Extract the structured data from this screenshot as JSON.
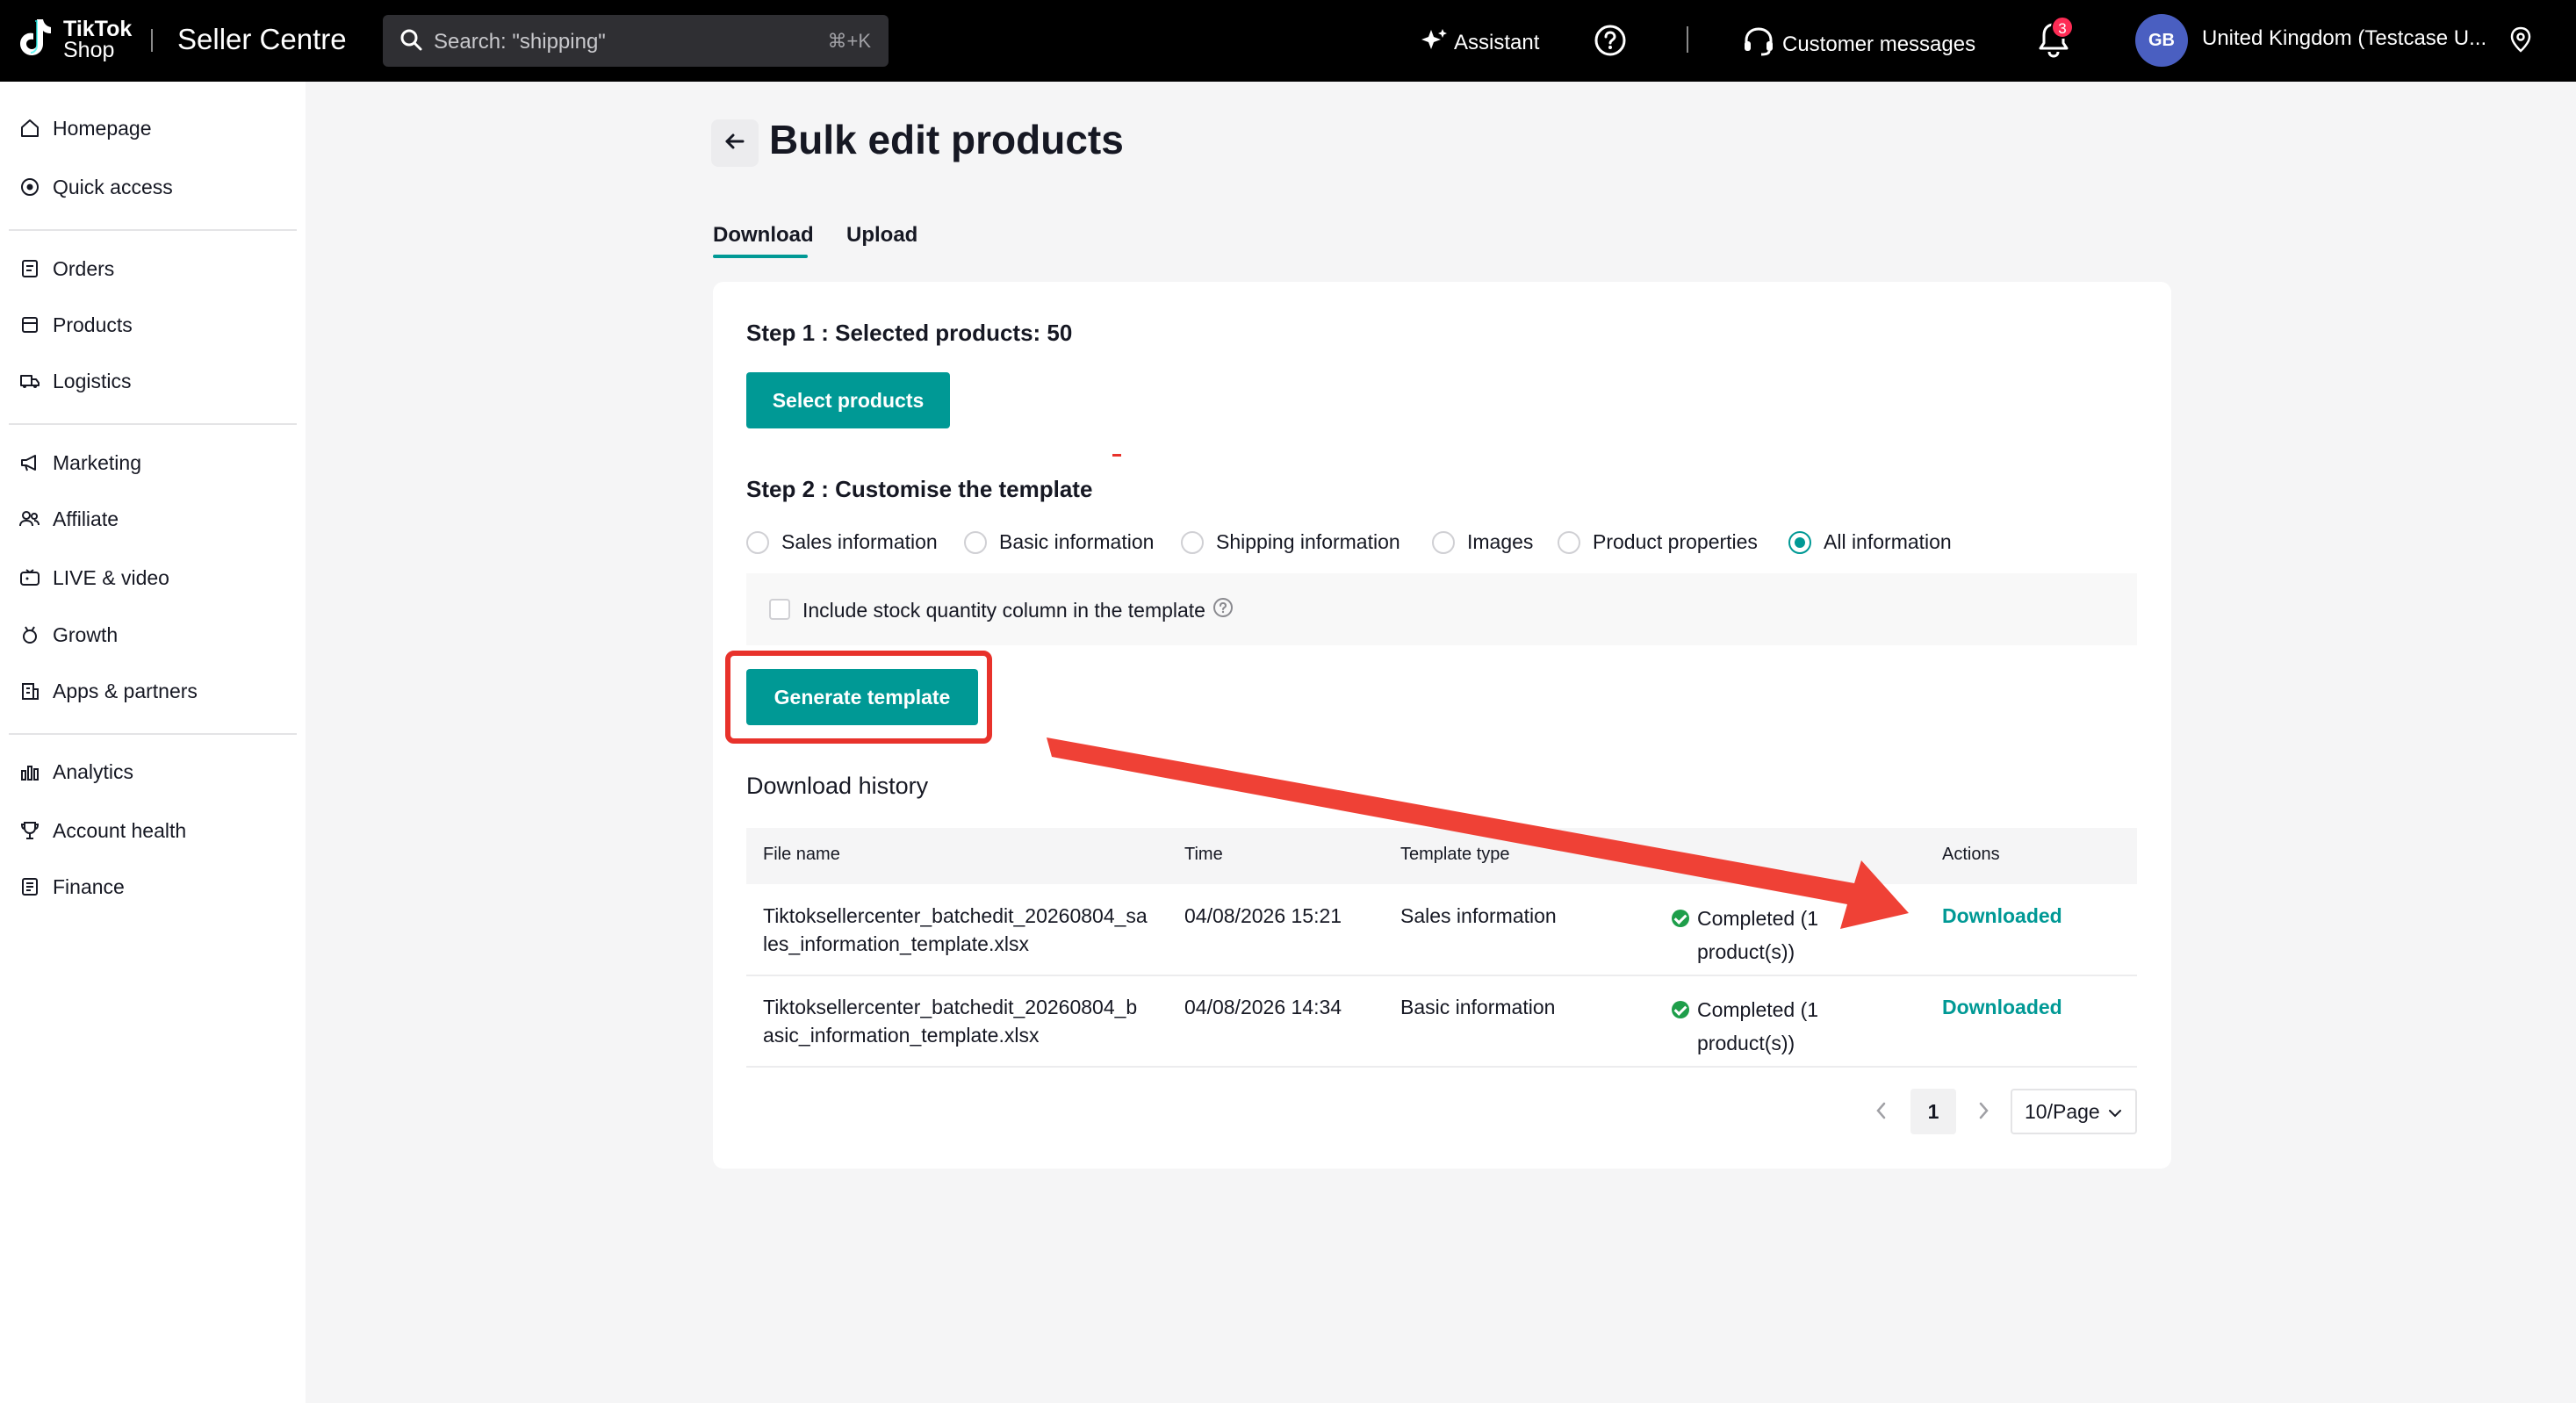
{
  "topbar": {
    "logo_line1": "TikTok",
    "logo_line2": "Shop",
    "brand": "Seller Centre",
    "search_placeholder": "Search: \"shipping\"",
    "search_shortcut": "⌘+K",
    "assistant": "Assistant",
    "customer_messages": "Customer messages",
    "notification_count": "3",
    "avatar_initials": "GB",
    "region": "United Kingdom  (Testcase U..."
  },
  "sidebar": {
    "items": [
      {
        "label": "Homepage",
        "icon": "home-icon"
      },
      {
        "label": "Quick access",
        "icon": "target-icon"
      },
      {
        "label": "Orders",
        "icon": "orders-icon"
      },
      {
        "label": "Products",
        "icon": "products-icon"
      },
      {
        "label": "Logistics",
        "icon": "truck-icon"
      },
      {
        "label": "Marketing",
        "icon": "megaphone-icon"
      },
      {
        "label": "Affiliate",
        "icon": "people-icon"
      },
      {
        "label": "LIVE & video",
        "icon": "live-icon"
      },
      {
        "label": "Growth",
        "icon": "medal-icon"
      },
      {
        "label": "Apps & partners",
        "icon": "building-icon"
      },
      {
        "label": "Analytics",
        "icon": "chart-icon"
      },
      {
        "label": "Account health",
        "icon": "trophy-icon"
      },
      {
        "label": "Finance",
        "icon": "ledger-icon"
      }
    ]
  },
  "page": {
    "title": "Bulk edit products",
    "tabs": [
      {
        "label": "Download",
        "active": true
      },
      {
        "label": "Upload",
        "active": false
      }
    ]
  },
  "step1": {
    "label": "Step 1 :  Selected products: 50",
    "button": "Select products"
  },
  "step2": {
    "label": "Step 2 :  Customise the template",
    "options": [
      {
        "label": "Sales information",
        "checked": false
      },
      {
        "label": "Basic information",
        "checked": false
      },
      {
        "label": "Shipping information",
        "checked": false
      },
      {
        "label": "Images",
        "checked": false
      },
      {
        "label": "Product properties",
        "checked": false
      },
      {
        "label": "All information",
        "checked": true
      }
    ],
    "stock_checkbox_label": "Include stock quantity column in the template",
    "generate_button": "Generate template"
  },
  "history": {
    "title": "Download history",
    "columns": [
      "File name",
      "Time",
      "Template type",
      "",
      "Actions"
    ],
    "rows": [
      {
        "file_line1": "Tiktoksellercenter_batchedit_20260804_sa",
        "file_line2": "les_information_template.xlsx",
        "time": "04/08/2026 15:21",
        "type": "Sales information",
        "status_line1": "Completed (1",
        "status_line2": "product(s))",
        "action": "Downloaded"
      },
      {
        "file_line1": "Tiktoksellercenter_batchedit_20260804_b",
        "file_line2": "asic_information_template.xlsx",
        "time": "04/08/2026 14:34",
        "type": "Basic information",
        "status_line1": "Completed (1",
        "status_line2": "product(s))",
        "action": "Downloaded"
      }
    ]
  },
  "pagination": {
    "current_page": "1",
    "page_size": "10/Page"
  },
  "colors": {
    "accent": "#009995",
    "annotation_red": "#e8322b",
    "success": "#1e9e4a"
  }
}
